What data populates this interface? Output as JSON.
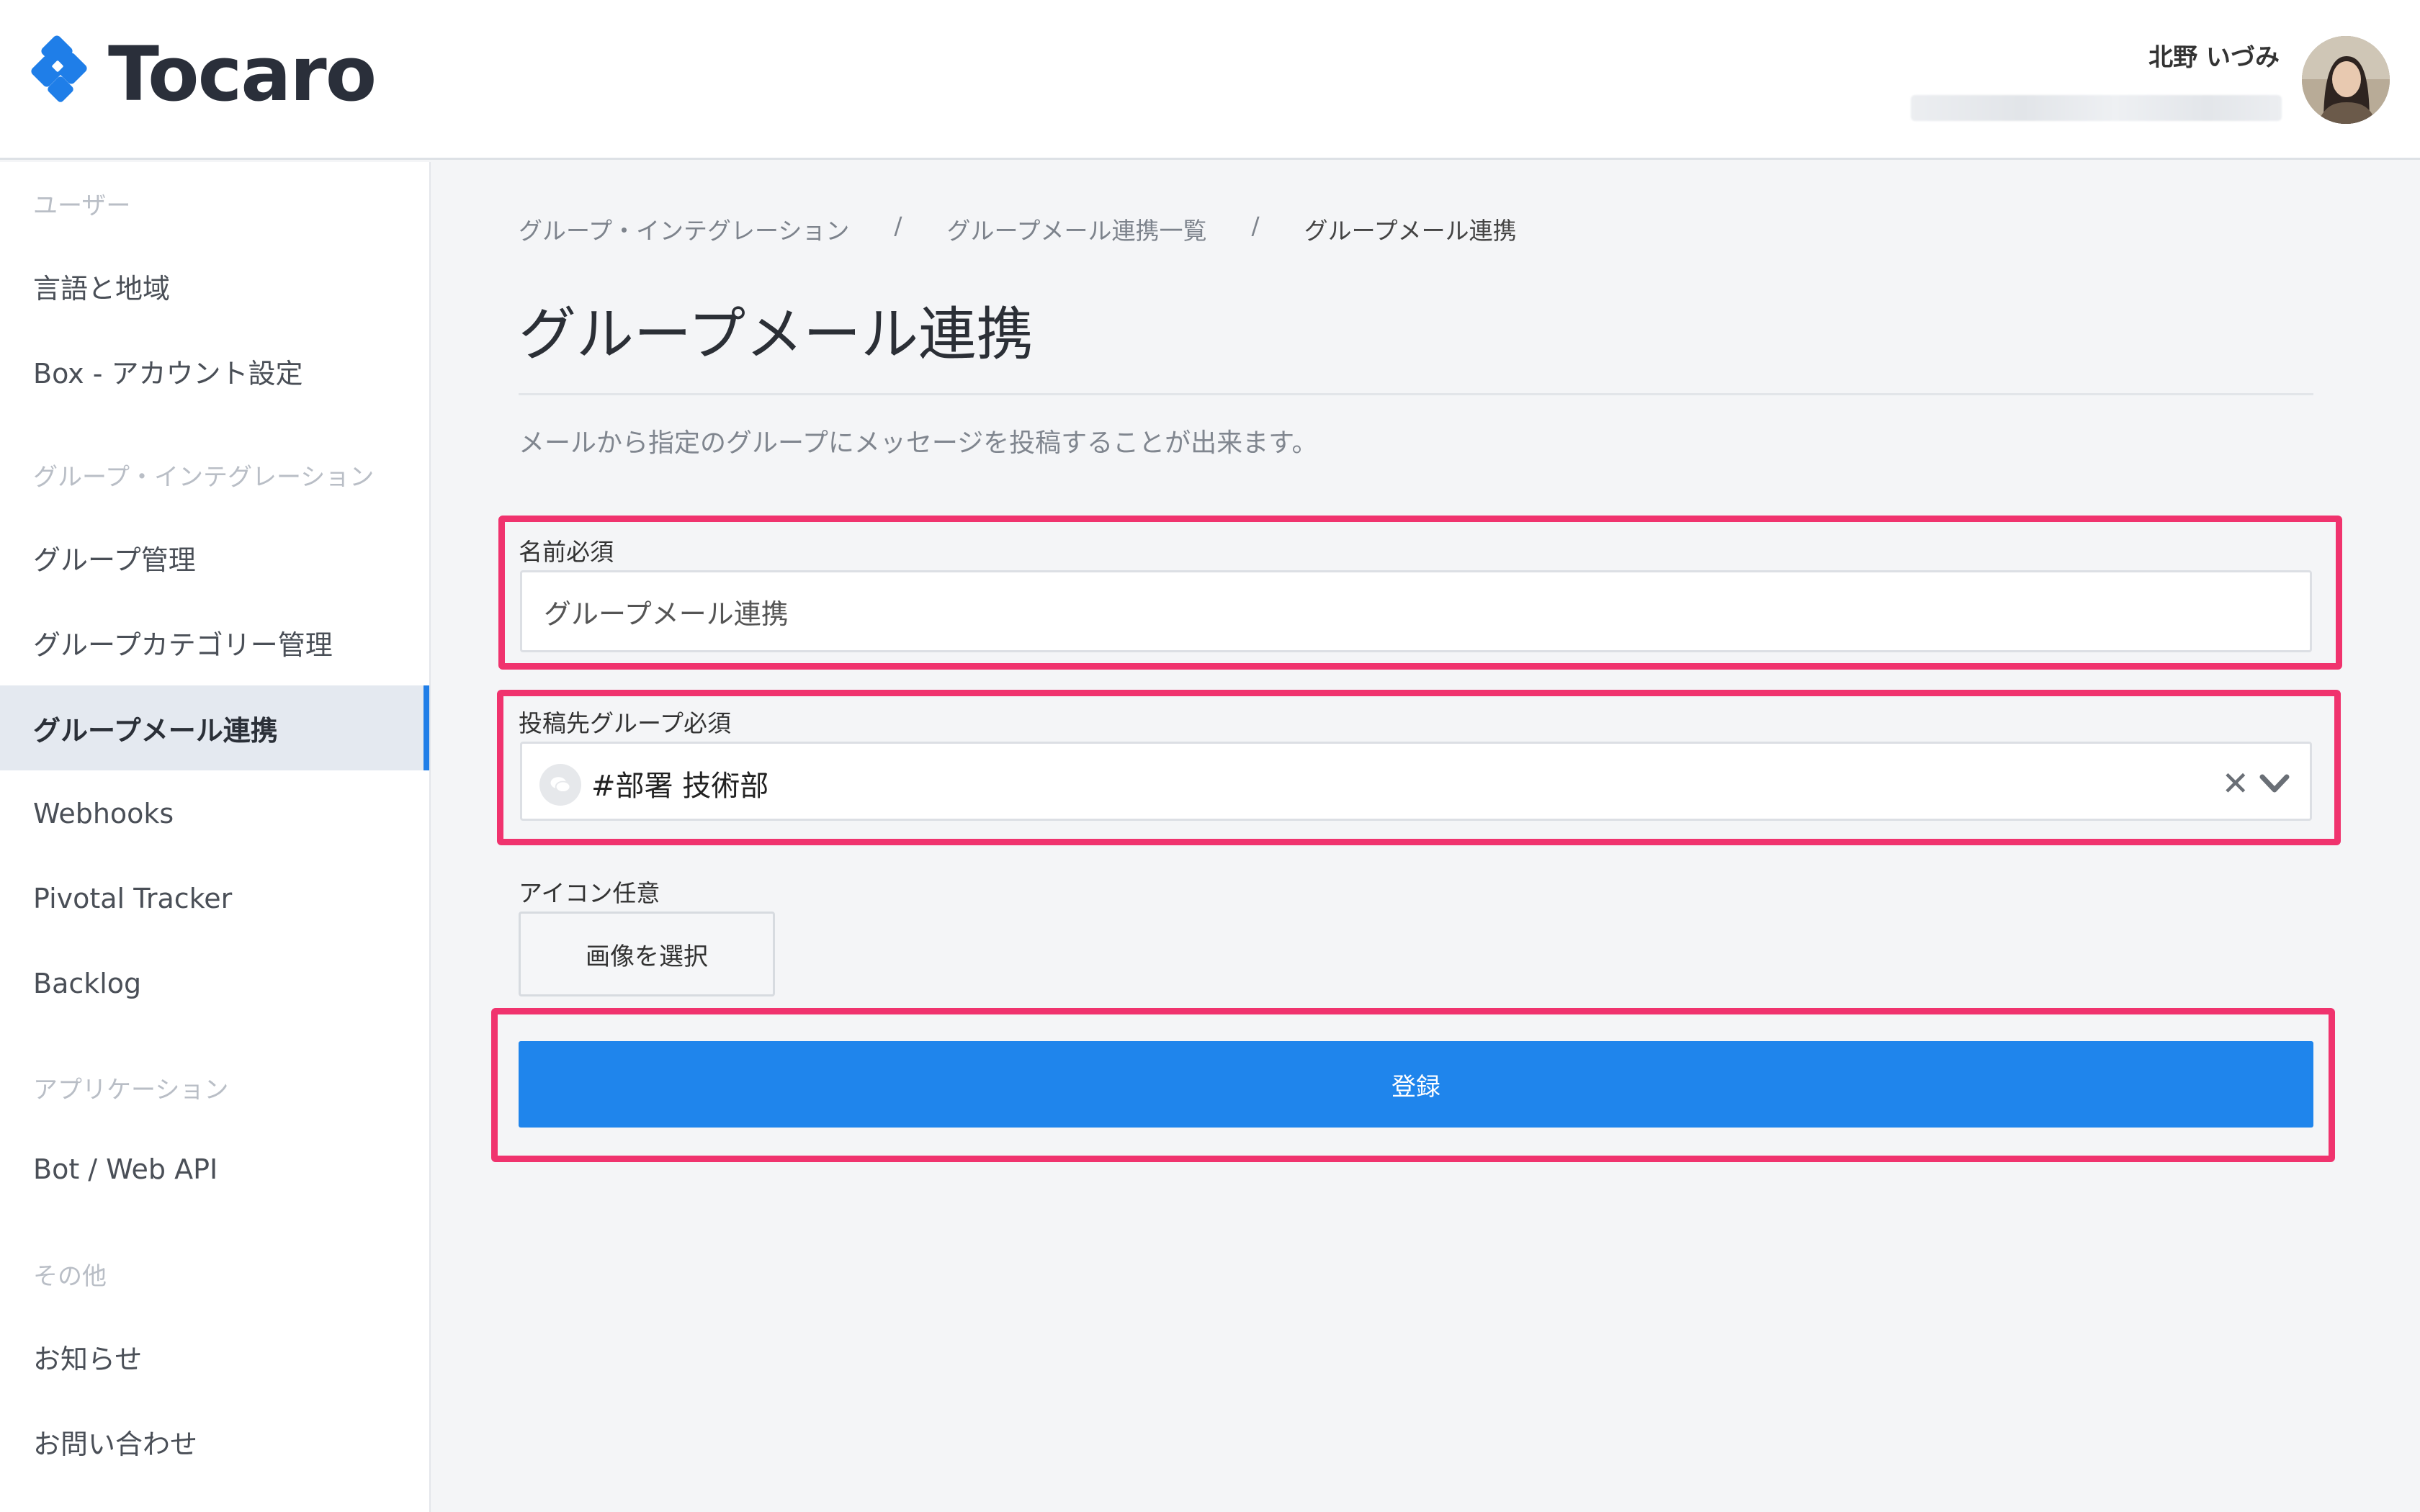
{
  "header": {
    "logo_text": "Tocaro",
    "user_name": "北野 いづみ"
  },
  "sidebar": {
    "sections": [
      {
        "label": "ユーザー"
      },
      {
        "label": "グループ・インテグレーション"
      },
      {
        "label": "アプリケーション"
      },
      {
        "label": "その他"
      }
    ],
    "items": [
      {
        "label": "言語と地域"
      },
      {
        "label": "Box - アカウント設定"
      },
      {
        "label": "グループ管理"
      },
      {
        "label": "グループカテゴリー管理"
      },
      {
        "label": "グループメール連携"
      },
      {
        "label": "Webhooks"
      },
      {
        "label": "Pivotal Tracker"
      },
      {
        "label": "Backlog"
      },
      {
        "label": "Bot / Web API"
      },
      {
        "label": "お知らせ"
      },
      {
        "label": "お問い合わせ"
      }
    ]
  },
  "breadcrumb": {
    "items": [
      "グループ・インテグレーション",
      "グループメール連携一覧",
      "グループメール連携"
    ],
    "separator": "/"
  },
  "page": {
    "title": "グループメール連携",
    "description": "メールから指定のグループにメッセージを投稿することが出来ます。"
  },
  "form": {
    "name_label": "名前必須",
    "name_value": "グループメール連携",
    "group_label": "投稿先グループ必須",
    "group_value": "#部署 技術部",
    "clear_symbol": "✕",
    "icon_label": "アイコン任意",
    "image_button": "画像を選択",
    "submit_button": "登録"
  },
  "colors": {
    "accent": "#1f85ec",
    "highlight": "#f0336e",
    "active_nav_bg": "#e4e9f0"
  }
}
